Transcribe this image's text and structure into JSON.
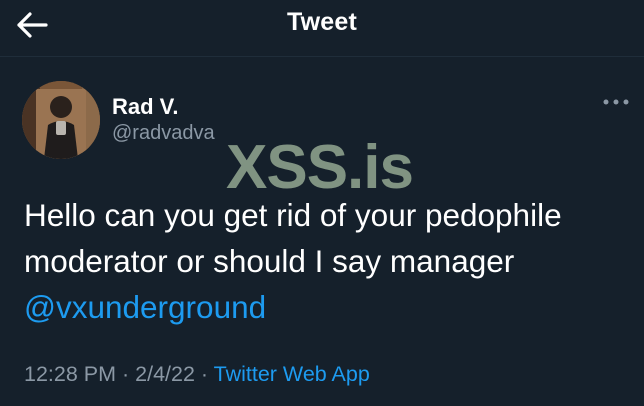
{
  "header": {
    "title": "Tweet"
  },
  "author": {
    "name": "Rad V.",
    "handle": "@radvadva"
  },
  "watermark": {
    "text": "XSS.is"
  },
  "tweet": {
    "text_line1": "Hello can you get rid of your pedophile",
    "text_line2": "moderator or should I say manager",
    "mention": "@vxunderground"
  },
  "meta": {
    "time": "12:28 PM",
    "separator1": " · ",
    "date": "2/4/22",
    "separator2": " · ",
    "source": "Twitter Web App"
  },
  "colors": {
    "background": "#15202b",
    "text": "#ffffff",
    "secondary_text": "#8b98a5",
    "link": "#1d9bf0",
    "watermark": "#98ad96"
  },
  "icons": {
    "back": "back-arrow-icon",
    "more": "more-dots-icon"
  }
}
